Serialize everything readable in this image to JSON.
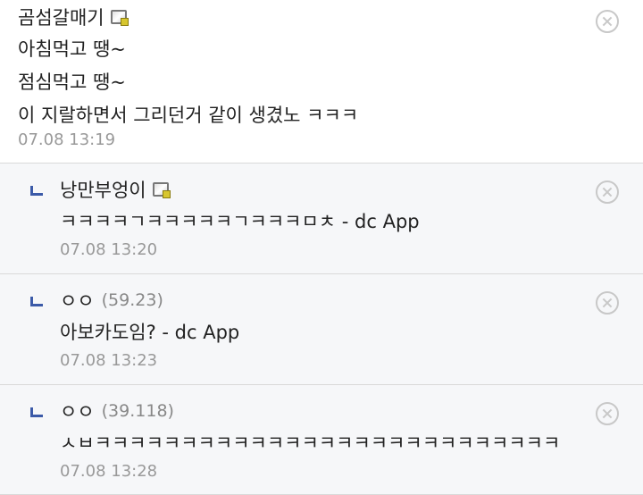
{
  "comments": [
    {
      "nickname": "곰섬갈매기",
      "ip": "",
      "lines": [
        "아침먹고 땡~",
        "점심먹고 땡~",
        "이 지랄하면서 그리던거 같이 생겼노 ㅋㅋㅋ"
      ],
      "time": "07.08 13:19",
      "member_icon": "fixed-nick-icon"
    }
  ],
  "replies": [
    {
      "nickname": "낭만부엉이",
      "ip": "",
      "text": "ㅋㅋㅋㅋㄱㅋㅋㅋㅋㅋㄱㅋㅋㅋㅁㅊ - dc App",
      "time": "07.08 13:20",
      "member_icon": "fixed-nick-icon"
    },
    {
      "nickname": "ㅇㅇ",
      "ip": "(59.23)",
      "text": "아보카도임? - dc App",
      "time": "07.08 13:23"
    },
    {
      "nickname": "ㅇㅇ",
      "ip": "(39.118)",
      "text": "ㅅㅂㅋㅋㅋㅋㅋㅋㅋㅋㅋㅋㅋㅋㅋㅋㅋㅋㅋㅋㅋㅋㅋㅋㅋㅋㅋㅋㅋ",
      "time": "07.08 13:28"
    }
  ],
  "icons": {
    "delete": "close-circle-icon",
    "reply": "reply-arrow-icon"
  },
  "colors": {
    "reply_background": "#f6f7f9",
    "reply_marker": "#3b5aa8",
    "meta_text": "#999999"
  }
}
